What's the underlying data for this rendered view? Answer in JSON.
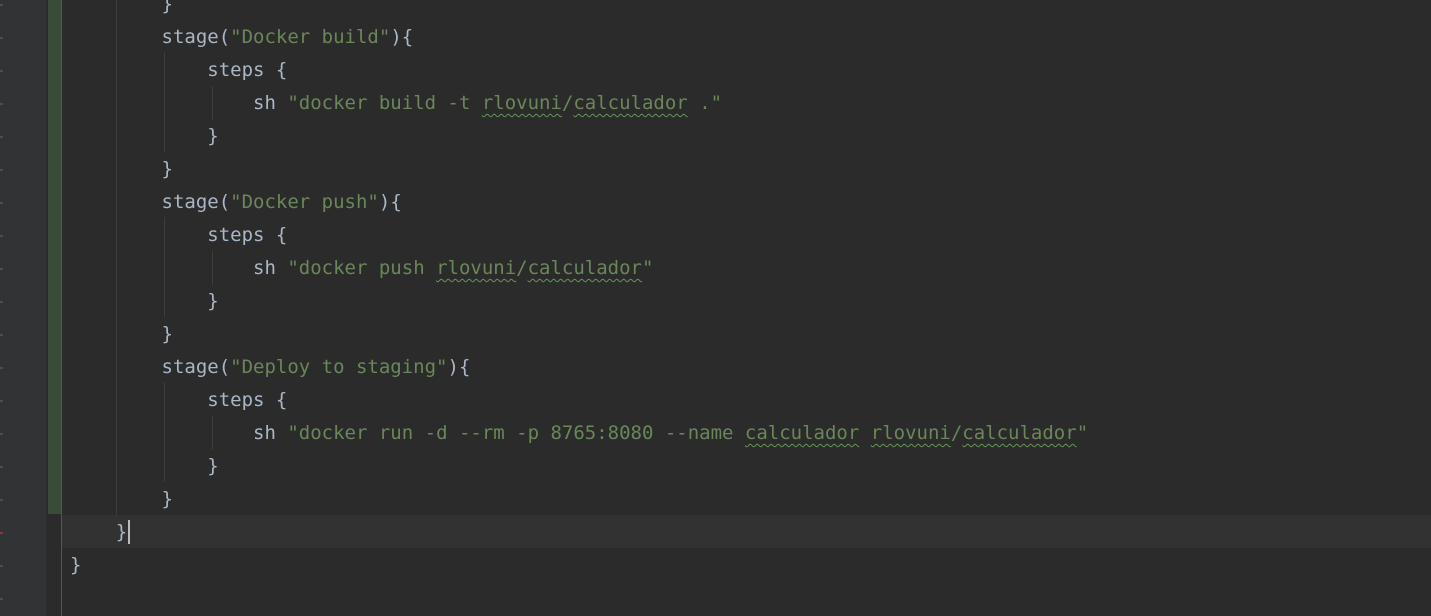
{
  "editor": {
    "lines": [
      {
        "indent": "        ",
        "segments": [
          {
            "t": "}",
            "k": "code"
          }
        ]
      },
      {
        "indent": "        ",
        "segments": [
          {
            "t": "stage(",
            "k": "code"
          },
          {
            "t": "\"Docker build\"",
            "k": "str"
          },
          {
            "t": "){",
            "k": "code"
          }
        ]
      },
      {
        "indent": "            ",
        "segments": [
          {
            "t": "steps {",
            "k": "code"
          }
        ]
      },
      {
        "indent": "                ",
        "segments": [
          {
            "t": "sh ",
            "k": "code"
          },
          {
            "t": "\"docker build -t ",
            "k": "str"
          },
          {
            "t": "rlovuni",
            "k": "strwarn"
          },
          {
            "t": "/",
            "k": "str"
          },
          {
            "t": "calculador",
            "k": "strwarn"
          },
          {
            "t": " .\"",
            "k": "str"
          }
        ]
      },
      {
        "indent": "            ",
        "segments": [
          {
            "t": "}",
            "k": "code"
          }
        ]
      },
      {
        "indent": "        ",
        "segments": [
          {
            "t": "}",
            "k": "code"
          }
        ]
      },
      {
        "indent": "        ",
        "segments": [
          {
            "t": "stage(",
            "k": "code"
          },
          {
            "t": "\"Docker push\"",
            "k": "str"
          },
          {
            "t": "){",
            "k": "code"
          }
        ]
      },
      {
        "indent": "            ",
        "segments": [
          {
            "t": "steps {",
            "k": "code"
          }
        ]
      },
      {
        "indent": "                ",
        "segments": [
          {
            "t": "sh ",
            "k": "code"
          },
          {
            "t": "\"docker push ",
            "k": "str"
          },
          {
            "t": "rlovuni",
            "k": "strwarn"
          },
          {
            "t": "/",
            "k": "str"
          },
          {
            "t": "calculador",
            "k": "strwarn"
          },
          {
            "t": "\"",
            "k": "str"
          }
        ]
      },
      {
        "indent": "            ",
        "segments": [
          {
            "t": "}",
            "k": "code"
          }
        ]
      },
      {
        "indent": "        ",
        "segments": [
          {
            "t": "}",
            "k": "code"
          }
        ]
      },
      {
        "indent": "        ",
        "segments": [
          {
            "t": "stage(",
            "k": "code"
          },
          {
            "t": "\"Deploy to staging\"",
            "k": "str"
          },
          {
            "t": "){",
            "k": "code"
          }
        ]
      },
      {
        "indent": "            ",
        "segments": [
          {
            "t": "steps {",
            "k": "code"
          }
        ]
      },
      {
        "indent": "                ",
        "segments": [
          {
            "t": "sh ",
            "k": "code"
          },
          {
            "t": "\"docker run -d --rm -p 8765:8080 --name ",
            "k": "str"
          },
          {
            "t": "calculador",
            "k": "strwarn"
          },
          {
            "t": " ",
            "k": "str"
          },
          {
            "t": "rlovuni",
            "k": "strwarn"
          },
          {
            "t": "/",
            "k": "str"
          },
          {
            "t": "calculador",
            "k": "strwarn"
          },
          {
            "t": "\"",
            "k": "str"
          }
        ]
      },
      {
        "indent": "            ",
        "segments": [
          {
            "t": "}",
            "k": "code"
          }
        ]
      },
      {
        "indent": "        ",
        "segments": [
          {
            "t": "}",
            "k": "code"
          }
        ]
      },
      {
        "indent": "    ",
        "segments": [
          {
            "t": "}",
            "k": "code"
          }
        ],
        "caret": true
      },
      {
        "indent": "",
        "segments": [
          {
            "t": "}",
            "k": "code"
          }
        ]
      }
    ]
  }
}
